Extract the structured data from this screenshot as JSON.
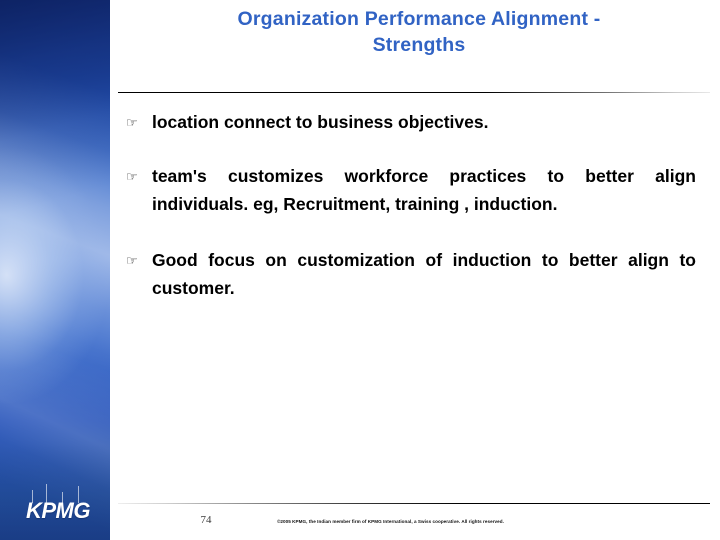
{
  "slide": {
    "title": "Organization Performance Alignment  -  Strengths",
    "title_line_1": "Organization Performance Alignment  -",
    "title_line_2": "Strengths",
    "title_color": "#3163c4",
    "background_color": "#ffffff"
  },
  "sidebar": {
    "accent_color_dark": "#17358a",
    "accent_color_mid": "#3569c9",
    "accent_color_light": "#93aee0",
    "logo": {
      "wordmark": "KPMG",
      "tick_count": 4
    }
  },
  "bullets": [
    {
      "marker": "☞",
      "marker_name": "pointing-hand-bullet",
      "text": "location connect to business objectives."
    },
    {
      "marker": "☞",
      "marker_name": "pointing-hand-bullet",
      "text": "team's customizes workforce practices to better align individuals. eg, Recruitment, training , induction."
    },
    {
      "marker": "☞",
      "marker_name": "pointing-hand-bullet",
      "text": "Good focus on customization of induction to better align to customer."
    }
  ],
  "footer": {
    "page_number": "74",
    "copyright": "©2005 KPMG, the Indian member firm of KPMG International, a Swiss cooperative. All rights reserved."
  }
}
